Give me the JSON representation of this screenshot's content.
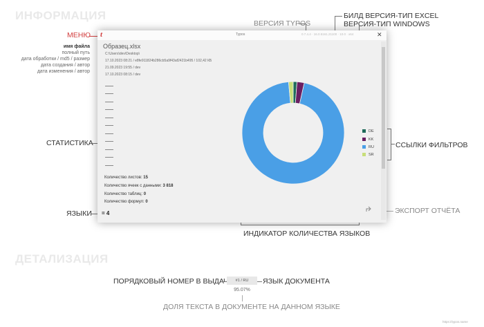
{
  "sections": {
    "info": "ИНФОРМАЦИЯ",
    "detail": "ДЕТАЛИЗАЦИЯ"
  },
  "callouts": {
    "menu": "МЕНЮ",
    "typos_version": "ВЕРСИЯ TYPOS",
    "excel_build": "БИЛД ВЕРСИЯ-ТИП EXCEL",
    "windows_version": "ВЕРСИЯ-ТИП WINDOWS",
    "statistics": "СТАТИСТИКА",
    "filter_links": "ССЫЛКИ ФИЛЬТРОВ",
    "languages": "ЯЗЫКИ",
    "export_report": "ЭКСПОРТ ОТЧЁТА",
    "language_count_indicator": "ИНДИКАТОР КОЛИЧЕСТВА ЯЗЫКОВ",
    "output_number": "ПОРЯДКОВЫЙ НОМЕР В ВЫДАЧЕ",
    "doc_language": "ЯЗЫК ДОКУМЕНТА",
    "text_share": "ДОЛЯ ТЕКСТА В ДОКУМЕНТЕ НА ДАННОМ ЯЗЫКЕ"
  },
  "meta_labels": [
    "имя файла",
    "полный путь",
    "дата обработки / md5 / размер",
    "дата создания / автор",
    "дата изменения / автор"
  ],
  "window": {
    "title": "Typos",
    "version_info": "0.7.4.4  ·  16.0.5161.21100  ·  10.0  ·  x64",
    "logo": "t",
    "close": "✕",
    "file": {
      "name": "Образец.xlsx",
      "path": "C:\\Users\\dev\\Desktop\\",
      "processed": "17.10.2023 08:21   /   e8fe911824b286cb5a9f43af2421b495   /   102,42 КБ",
      "created": "21.09.2023 19:55   /   dev",
      "modified": "17.10.2023 08:15   /   dev"
    },
    "stats": [
      {
        "label": "Количество листов:",
        "value": "15"
      },
      {
        "label": "Количество ячеек с данными:",
        "value": "3 818"
      },
      {
        "label": "Количество таблиц:",
        "value": "0"
      },
      {
        "label": "Количество формул:",
        "value": "0"
      }
    ],
    "language_count": "= 4",
    "share_icon": "share-icon"
  },
  "badge": {
    "label": "#1  /  RU",
    "percent": "95.07%"
  },
  "watermark": "https://typos.name",
  "colors": {
    "accent": "#d23c3c",
    "DE": "#1f6b5a",
    "KK": "#6a1f62",
    "RU": "#4a9fe6",
    "SR": "#c8df7a"
  },
  "chart_data": {
    "type": "pie",
    "donut": true,
    "categories": [
      "DE",
      "KK",
      "RU",
      "SR"
    ],
    "values": [
      1.2,
      2.3,
      95.07,
      1.43
    ],
    "colors": [
      "#1f6b5a",
      "#6a1f62",
      "#4a9fe6",
      "#c8df7a"
    ],
    "legend_position": "right"
  }
}
